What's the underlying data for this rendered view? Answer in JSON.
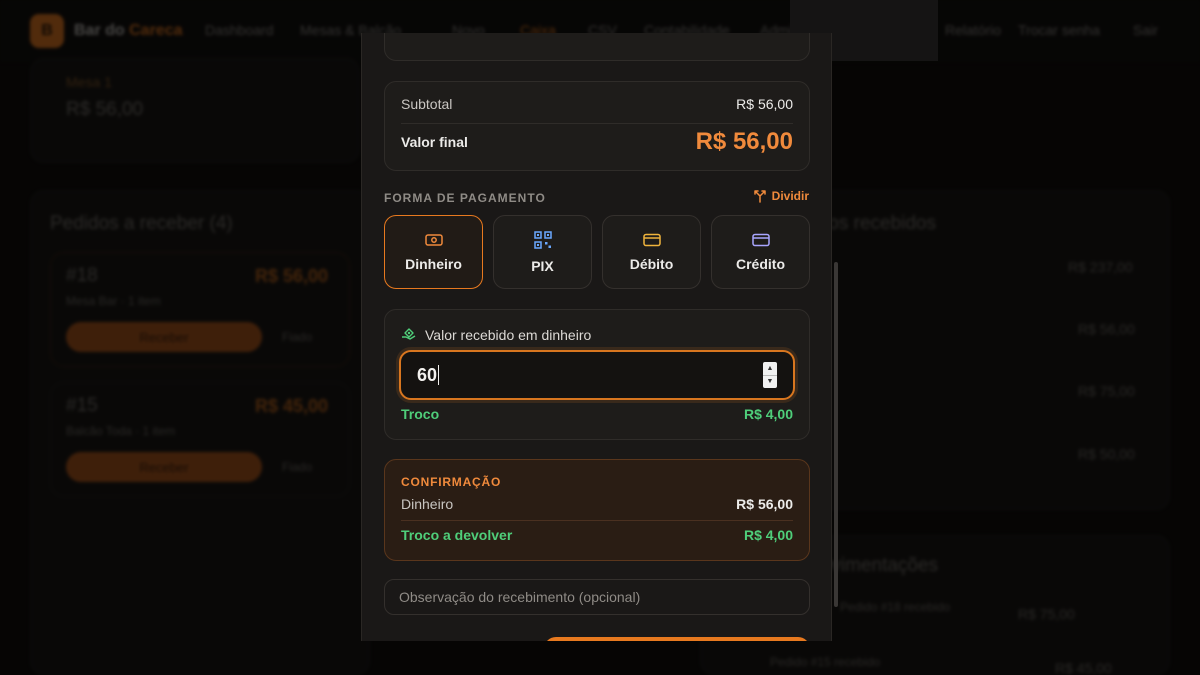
{
  "background": {
    "brand_initial": "B",
    "brand_prefix": "Bar do ",
    "brand_suffix": "Careca",
    "nav": [
      "Dashboard",
      "Mesas & Balcão",
      "Novo",
      "Caixa",
      "CSV",
      "Contabilidade",
      "Admin",
      "Relatório",
      "Trocar senha",
      "Sair"
    ],
    "active_nav": "Caixa",
    "table_label": "Mesa 1",
    "table_value": "R$ 56,00",
    "orders_title": "Pedidos a receber (4)",
    "orders": [
      {
        "id": "#18",
        "amount": "R$ 56,00",
        "meta": "Mesa Bar · 1 item",
        "button": "Receber",
        "aside": "Fiado"
      },
      {
        "id": "#15",
        "amount": "R$ 45,00",
        "meta": "Balcão Toda · 1 item",
        "button": "Receber",
        "aside": "Fiado"
      }
    ],
    "right_title": "Últimos recebidos",
    "right_values": [
      "R$ 237,00",
      "R$ 56,00",
      "R$ 75,00",
      "R$ 50,00"
    ],
    "moves_title": "Movimentações",
    "moves": [
      {
        "label": "Pedido #18 recebido",
        "value": "R$ 75,00"
      },
      {
        "label": "Pedido #15 recebido",
        "value": "R$ 45,00"
      }
    ]
  },
  "summary": {
    "subtotal_label": "Subtotal",
    "subtotal_value": "R$ 56,00",
    "final_label": "Valor final",
    "final_value": "R$ 56,00"
  },
  "payment": {
    "section_title": "FORMA DE PAGAMENTO",
    "split_label": "Dividir",
    "methods": [
      {
        "label": "Dinheiro",
        "icon": "cash-icon",
        "selected": true
      },
      {
        "label": "PIX",
        "icon": "qr-code-icon",
        "selected": false
      },
      {
        "label": "Débito",
        "icon": "card-icon",
        "selected": false
      },
      {
        "label": "Crédito",
        "icon": "card-icon",
        "selected": false
      }
    ]
  },
  "cash": {
    "title": "Valor recebido em dinheiro",
    "input_value": "60",
    "change_label": "Troco",
    "change_value": "R$ 4,00"
  },
  "confirmation": {
    "title": "CONFIRMAÇÃO",
    "method_label": "Dinheiro",
    "method_value": "R$ 56,00",
    "change_label": "Troco a devolver",
    "change_value": "R$ 4,00"
  },
  "observation": {
    "placeholder": "Observação do recebimento (opcional)"
  },
  "colors": {
    "accent": "#f08a3c",
    "success": "#4fce7a",
    "background": "#1a1817"
  }
}
